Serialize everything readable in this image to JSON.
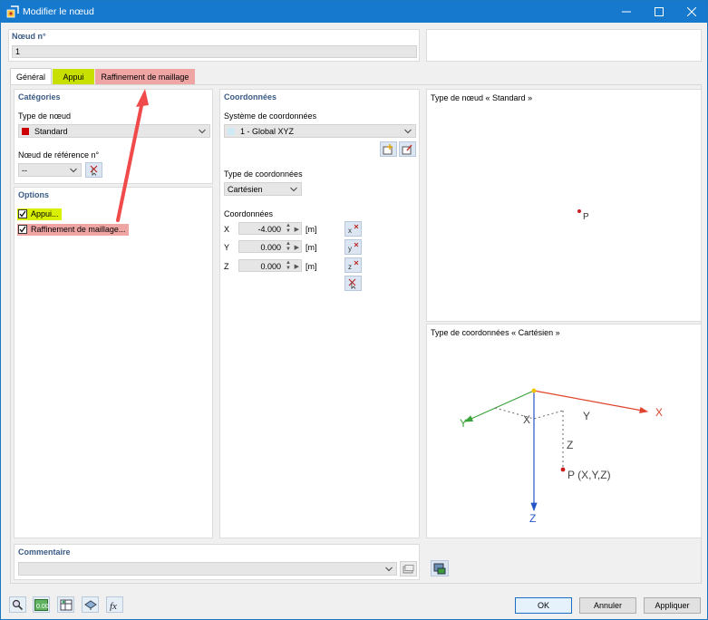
{
  "window": {
    "title": "Modifier le nœud",
    "controls": {
      "minimize": "—",
      "maximize": "☐",
      "close": "✕"
    }
  },
  "node": {
    "label": "Nœud n°",
    "value": "1"
  },
  "tabs": [
    {
      "label": "Général",
      "active": true
    },
    {
      "label": "Appui",
      "color": "#c8e000"
    },
    {
      "label": "Raffinement de maillage",
      "color": "#f0a5a5"
    }
  ],
  "categories": {
    "header": "Catégories",
    "node_type_label": "Type de nœud",
    "node_type_value": "Standard",
    "node_type_color": "#cc0000",
    "ref_label": "Nœud de référence n°",
    "ref_value": "--"
  },
  "options": {
    "header": "Options",
    "items": [
      {
        "label": "Appui...",
        "checked": true,
        "color": "#d9f000"
      },
      {
        "label": "Raffinement de maillage...",
        "checked": true,
        "color": "#f0a5a5"
      }
    ]
  },
  "coordinates": {
    "header": "Coordonnées",
    "system_label": "Système de coordonnées",
    "system_value": "1 - Global XYZ",
    "type_label": "Type de coordonnées",
    "type_value": "Cartésien",
    "coords_label": "Coordonnées",
    "rows": [
      {
        "axis": "X",
        "value": "-4.000",
        "unit": "[m]"
      },
      {
        "axis": "Y",
        "value": "0.000",
        "unit": "[m]"
      },
      {
        "axis": "Z",
        "value": "0.000",
        "unit": "[m]"
      }
    ]
  },
  "preview": {
    "node_type_caption": "Type de nœud « Standard »",
    "point_label": "P",
    "coord_type_caption": "Type de coordonnées « Cartésien »",
    "diagram": {
      "x_axis": "X",
      "y_axis": "Y",
      "z_axis": "Z",
      "dim_x": "X",
      "dim_y": "Y",
      "dim_z": "Z",
      "point_label": "P (X,Y,Z)",
      "colors": {
        "x": "#e0442c",
        "y": "#3aa33a",
        "z": "#2454c8",
        "point": "#c81e1e",
        "origin": "#f2c200"
      }
    }
  },
  "comment": {
    "header": "Commentaire",
    "value": ""
  },
  "buttons": {
    "ok": "OK",
    "cancel": "Annuler",
    "apply": "Appliquer"
  },
  "annotation_color": "#f04a4a"
}
